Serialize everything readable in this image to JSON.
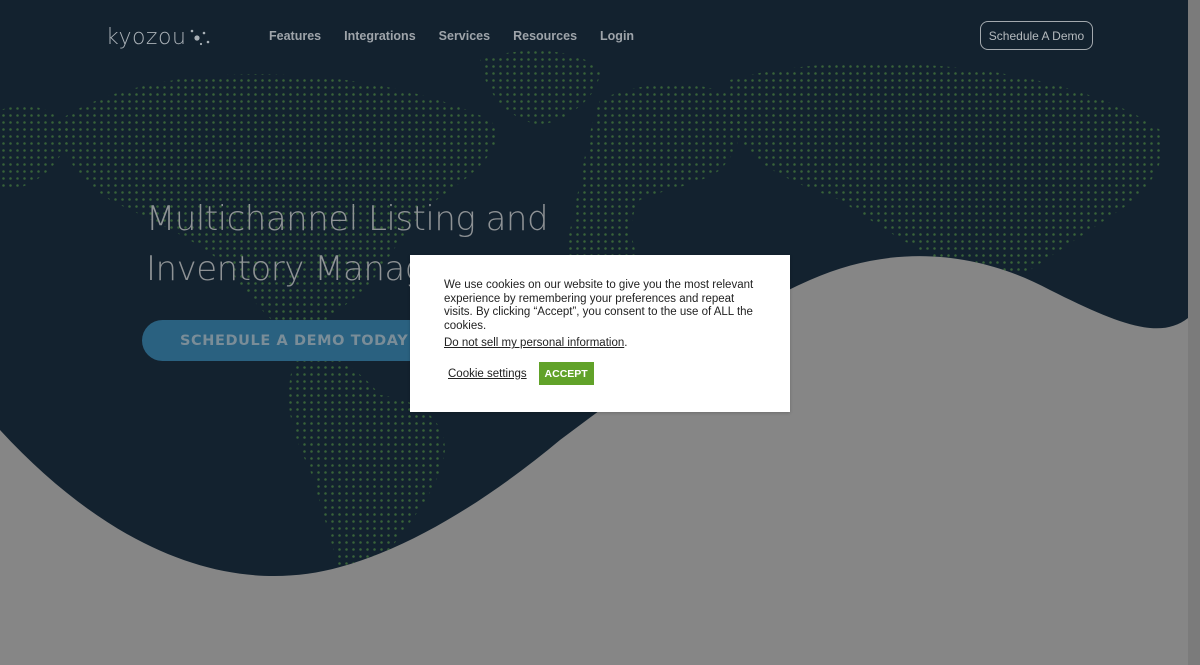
{
  "brand": {
    "name": "kyozou"
  },
  "nav": {
    "items": [
      {
        "label": "Features"
      },
      {
        "label": "Integrations"
      },
      {
        "label": "Services"
      },
      {
        "label": "Resources"
      },
      {
        "label": "Login"
      }
    ],
    "cta_label": "Schedule A Demo"
  },
  "hero": {
    "headline_line1": "Multichannel Listing and",
    "headline_line2": "Inventory Management",
    "cta_label": "SCHEDULE A DEMO TODAY"
  },
  "cookie_banner": {
    "message": "We use cookies on our website to give you the most relevant experience by remembering your preferences and repeat visits. By clicking “Accept”, you consent to the use of ALL the cookies.",
    "do_not_sell_label": "Do not sell my personal information",
    "settings_label": "Cookie settings",
    "accept_label": "ACCEPT"
  },
  "colors": {
    "overlay": "#868686",
    "hero_dark": "#13222f",
    "map_dots": "#3c6a3a",
    "accept_green": "#61a229",
    "cta_blue": "#2a6180"
  }
}
